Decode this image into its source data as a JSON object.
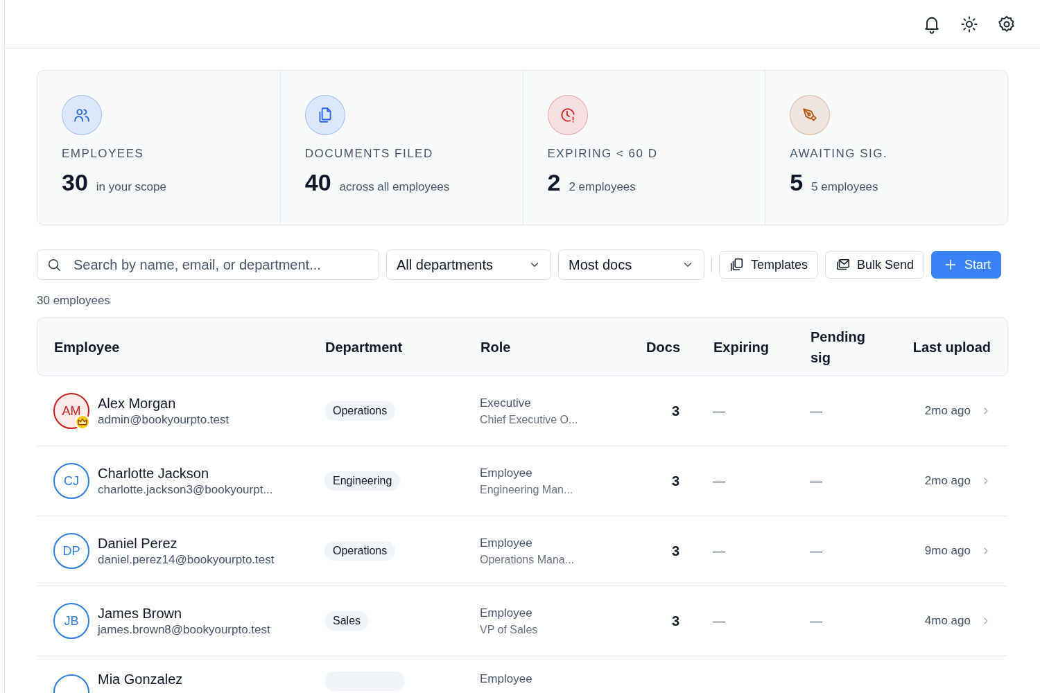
{
  "stats": [
    {
      "kind": "people",
      "label": "EMPLOYEES",
      "value": "30",
      "note": "in your scope",
      "color": "#2563eb"
    },
    {
      "kind": "documents",
      "label": "DOCUMENTS FILED",
      "value": "40",
      "note": "across all employees",
      "color": "#2563eb"
    },
    {
      "kind": "clock",
      "label": "EXPIRING < 60 D",
      "value": "2",
      "note": "2 employees",
      "color": "#dc2626"
    },
    {
      "kind": "pen",
      "label": "AWAITING SIG.",
      "value": "5",
      "note": "5 employees",
      "color": "#b45309"
    }
  ],
  "toolbar": {
    "search": {
      "placeholder": "Search by name, email, or department..."
    },
    "filters": [
      {
        "value": "All departments"
      },
      {
        "value": "Most docs"
      }
    ],
    "buttons": [
      {
        "kind": "templates",
        "label": "Templates",
        "primary": false
      },
      {
        "kind": "bulk",
        "label": "Bulk Send",
        "primary": false
      },
      {
        "kind": "start",
        "label": "Start",
        "primary": true
      }
    ]
  },
  "count": "30 employees",
  "table": {
    "columns": [
      "Employee",
      "Department",
      "Role",
      "Docs",
      "Expiring",
      "Pending sig",
      "Last upload"
    ],
    "rows": [
      {
        "initials": "AM",
        "color": "#c81e1e",
        "admin": true,
        "name": "Alex Morgan",
        "email": "admin@bookyourpto.test",
        "department": "Operations",
        "role": "Executive",
        "title": "Chief Executive O...",
        "docs": "3",
        "expiring": "—",
        "pending": "—",
        "last_upload": "2mo ago"
      },
      {
        "initials": "CJ",
        "color": "#2f7ddf",
        "admin": false,
        "name": "Charlotte Jackson",
        "email": "charlotte.jackson3@bookyourpt...",
        "department": "Engineering",
        "role": "Employee",
        "title": "Engineering Man...",
        "docs": "3",
        "expiring": "—",
        "pending": "—",
        "last_upload": "2mo ago"
      },
      {
        "initials": "DP",
        "color": "#2f7ddf",
        "admin": false,
        "name": "Daniel Perez",
        "email": "daniel.perez14@bookyourpto.test",
        "department": "Operations",
        "role": "Employee",
        "title": "Operations Mana...",
        "docs": "3",
        "expiring": "—",
        "pending": "—",
        "last_upload": "9mo ago"
      },
      {
        "initials": "JB",
        "color": "#2f7ddf",
        "admin": false,
        "name": "James Brown",
        "email": "james.brown8@bookyourpto.test",
        "department": "Sales",
        "role": "Employee",
        "title": "VP of Sales",
        "docs": "3",
        "expiring": "—",
        "pending": "—",
        "last_upload": "4mo ago"
      },
      {
        "color": "#2f7ddf",
        "admin": false,
        "name": "Mia Gonzalez",
        "role": "Employee"
      }
    ]
  }
}
